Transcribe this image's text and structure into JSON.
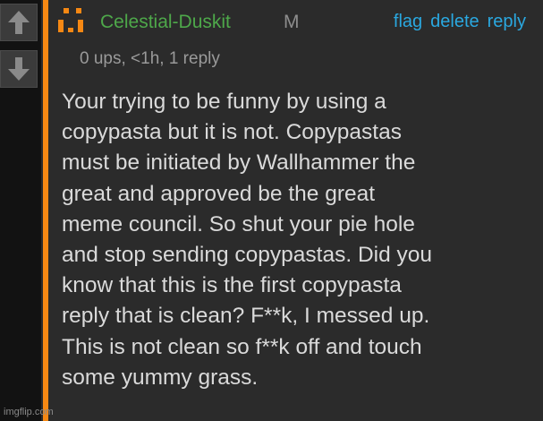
{
  "comment": {
    "username": "Celestial-Duskit",
    "gender": "M",
    "meta": "0 ups, <1h, 1 reply",
    "actions": {
      "flag": "flag",
      "delete": "delete",
      "reply": "reply"
    },
    "body": "Your trying to be funny by using a\ncopypasta but it is not. Copypastas\nmust be initiated by Wallhammer the\ngreat and approved be the great\nmeme council. So shut your pie hole\nand stop sending copypastas. Did you\nknow that this is the first copypasta\nreply that is clean? F**k, I messed up.\nThis is not clean so f**k off and touch\nsome yummy grass."
  },
  "icons": {
    "upvote": "arrow-up-icon",
    "downvote": "arrow-down-icon",
    "avatar": "pixel-avatar-icon"
  },
  "colors": {
    "accent_bar": "#f68813",
    "username": "#4ea84a",
    "links": "#2aa8e0",
    "body_text": "#dadada",
    "background": "#2b2b2b"
  },
  "watermark": "imgflip.com"
}
